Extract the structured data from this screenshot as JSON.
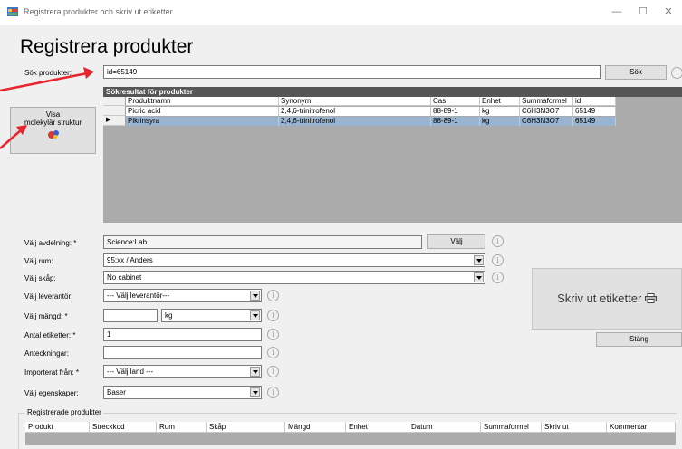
{
  "window": {
    "title": "Registrera produkter och skriv ut etiketter.",
    "minimize": "—",
    "maximize": "☐",
    "close": "✕"
  },
  "page_title": "Registrera produkter",
  "search": {
    "label": "Sök produkter:",
    "value": "id=65149",
    "button": "Sök"
  },
  "molecule_button": {
    "line1": "Visa",
    "line2": "molekylär struktur"
  },
  "results": {
    "caption": "Sökresultat för produkter",
    "columns": [
      "Produktnamn",
      "Synonym",
      "Cas",
      "Enhet",
      "Summaformel",
      "id"
    ],
    "rows": [
      {
        "Produktnamn": "Picric acid",
        "Synonym": "2,4,6-trinitrofenol",
        "Cas": "88-89-1",
        "Enhet": "kg",
        "Summaformel": "C6H3N3O7",
        "id": "65149",
        "selected": false
      },
      {
        "Produktnamn": "Pikrinsyra",
        "Synonym": "2,4,6-trinitrofenol",
        "Cas": "88-89-1",
        "Enhet": "kg",
        "Summaformel": "C6H3N3O7",
        "id": "65149",
        "selected": true
      }
    ],
    "current_row_marker": "▶"
  },
  "form": {
    "avdelning": {
      "label": "Välj avdelning: *",
      "value": "Science:Lab",
      "button": "Välj"
    },
    "rum": {
      "label": "Välj rum:",
      "value": "95:xx / Anders"
    },
    "skap": {
      "label": "Välj skåp:",
      "value": "No cabinet"
    },
    "leverantor": {
      "label": "Välj leverantör:",
      "value": "--- Välj leverantör---"
    },
    "mangd": {
      "label": "Välj mängd: *",
      "value": "",
      "unit": "kg"
    },
    "antal": {
      "label": "Antal etiketter: *",
      "value": "1"
    },
    "anteckningar": {
      "label": "Anteckningar:",
      "value": ""
    },
    "importerat": {
      "label": "Importerat från: *",
      "value": "--- Välj land ---"
    },
    "egenskaper": {
      "label": "Välj egenskaper:",
      "value": "Baser"
    }
  },
  "info_glyph": "i",
  "print_button": {
    "label": "Skriv ut etiketter",
    "icon": "printer-icon"
  },
  "close_button": "Stäng",
  "registered": {
    "title": "Registrerade produkter",
    "columns": [
      "Produkt",
      "Streckkod",
      "Rum",
      "Skåp",
      "Mängd",
      "Enhet",
      "Datum",
      "Summaformel",
      "Skriv ut",
      "Kommentar"
    ]
  },
  "colors": {
    "annotation_arrow": "#e8242c",
    "grid_bg": "#ababab",
    "caption_bg": "#565656",
    "selected_row": "#99b4d1"
  }
}
